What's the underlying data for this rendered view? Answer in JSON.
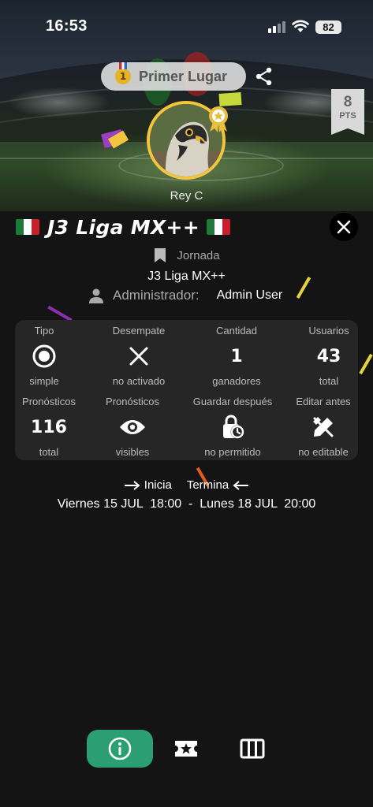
{
  "status_bar": {
    "time": "16:53",
    "battery": "82"
  },
  "header": {
    "rank_label": "Primer Lugar",
    "rank_number": "1",
    "points": "8",
    "points_unit": "PTS",
    "player_name": "Rey C"
  },
  "league": {
    "title": "J3 Liga MX++",
    "jornada_label": "Jornada",
    "jornada_value": "J3 Liga MX++",
    "admin_label": "Administrador:",
    "admin_value": "Admin User"
  },
  "stats": [
    {
      "title": "Tipo",
      "icon": "radio-icon",
      "value": "",
      "sub": "simple"
    },
    {
      "title": "Desempate",
      "icon": "x-icon",
      "value": "",
      "sub": "no activado"
    },
    {
      "title": "Cantidad",
      "icon": "",
      "value": "1",
      "sub": "ganadores"
    },
    {
      "title": "Usuarios",
      "icon": "",
      "value": "43",
      "sub": "total"
    },
    {
      "title": "Pronósticos",
      "icon": "",
      "value": "116",
      "sub": "total"
    },
    {
      "title": "Pronósticos",
      "icon": "eye-icon",
      "value": "",
      "sub": "visibles"
    },
    {
      "title": "Guardar después",
      "icon": "lock-clock-icon",
      "value": "",
      "sub": "no permitido"
    },
    {
      "title": "Editar antes",
      "icon": "no-edit-icon",
      "value": "",
      "sub": "no editable"
    }
  ],
  "dates": {
    "start_label": "Inicia",
    "end_label": "Termina",
    "range": "Viernes 15 JUL  18:00  -  Lunes 18 JUL  20:00"
  },
  "nav": {
    "items": [
      "info-icon",
      "ticket-star-icon",
      "columns-icon"
    ],
    "active": 0
  },
  "colors": {
    "accent": "#2b9e74",
    "gold": "#f2c53d",
    "background": "#141414",
    "card": "#262626"
  }
}
